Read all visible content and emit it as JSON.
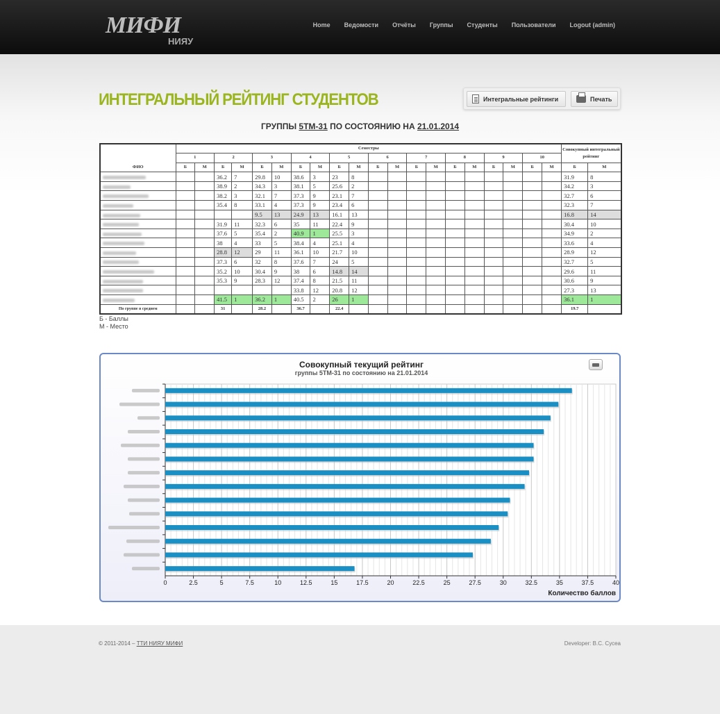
{
  "nav": {
    "logo_text": "МИФИ",
    "logo_sub": "НИЯУ",
    "items": [
      "Home",
      "Ведомости",
      "Отчёты",
      "Группы",
      "Студенты",
      "Пользователи",
      "Logout (admin)"
    ]
  },
  "page": {
    "title": "ИНТЕГРАЛЬНЫЙ РЕЙТИНГ СТУДЕНТОВ",
    "btn_ratings": "Интегральные рейтинги",
    "btn_print": "Печать",
    "subtitle_pre": "ГРУППЫ",
    "group": "5ТМ-31",
    "subtitle_mid": "ПО СОСТОЯНИЮ НА",
    "date": "21.01.2014"
  },
  "table": {
    "col_fio": "ФИО",
    "col_semesters": "Семестры",
    "col_total": "Совокупный интегральный рейтинг",
    "col_b": "Б",
    "col_m": "М",
    "semesters": [
      "1",
      "2",
      "3",
      "4",
      "5",
      "6",
      "7",
      "8",
      "9",
      "10"
    ],
    "rows": [
      {
        "blur": 62,
        "s2": [
          "36.2",
          "7",
          ""
        ],
        "s3": [
          "29.8",
          "10",
          ""
        ],
        "s4": [
          "38.6",
          "3",
          ""
        ],
        "s5": [
          "23",
          "8",
          ""
        ],
        "t": [
          "31.9",
          "8",
          ""
        ]
      },
      {
        "blur": 40,
        "s2": [
          "38.9",
          "2",
          ""
        ],
        "s3": [
          "34.3",
          "3",
          ""
        ],
        "s4": [
          "38.1",
          "5",
          ""
        ],
        "s5": [
          "25.6",
          "2",
          ""
        ],
        "t": [
          "34.2",
          "3",
          ""
        ]
      },
      {
        "blur": 66,
        "s2": [
          "38.2",
          "3",
          ""
        ],
        "s3": [
          "32.1",
          "7",
          ""
        ],
        "s4": [
          "37.3",
          "9",
          ""
        ],
        "s5": [
          "23.1",
          "7",
          ""
        ],
        "t": [
          "32.7",
          "6",
          ""
        ]
      },
      {
        "blur": 44,
        "s2": [
          "35.4",
          "8",
          ""
        ],
        "s3": [
          "33.1",
          "4",
          ""
        ],
        "s4": [
          "37.3",
          "9",
          ""
        ],
        "s5": [
          "23.4",
          "6",
          ""
        ],
        "t": [
          "32.3",
          "7",
          ""
        ]
      },
      {
        "blur": 54,
        "s2": [
          "",
          "",
          ""
        ],
        "s3": [
          "9.5",
          "13",
          "g"
        ],
        "s4": [
          "24.9",
          "13",
          "g"
        ],
        "s5": [
          "16.1",
          "13",
          ""
        ],
        "t": [
          "16.8",
          "14",
          "g"
        ]
      },
      {
        "blur": 52,
        "s2": [
          "31.9",
          "11",
          ""
        ],
        "s3": [
          "32.3",
          "6",
          ""
        ],
        "s4": [
          "35",
          "11",
          ""
        ],
        "s5": [
          "22.4",
          "9",
          ""
        ],
        "t": [
          "30.4",
          "10",
          ""
        ]
      },
      {
        "blur": 56,
        "s2": [
          "37.6",
          "5",
          ""
        ],
        "s3": [
          "35.4",
          "2",
          ""
        ],
        "s4": [
          "40.9",
          "1",
          "gr"
        ],
        "s5": [
          "25.5",
          "3",
          ""
        ],
        "t": [
          "34.9",
          "2",
          ""
        ]
      },
      {
        "blur": 60,
        "s2": [
          "38",
          "4",
          ""
        ],
        "s3": [
          "33",
          "5",
          ""
        ],
        "s4": [
          "38.4",
          "4",
          ""
        ],
        "s5": [
          "25.1",
          "4",
          ""
        ],
        "t": [
          "33.6",
          "4",
          ""
        ]
      },
      {
        "blur": 48,
        "s2": [
          "28.8",
          "12",
          "g"
        ],
        "s3": [
          "29",
          "11",
          ""
        ],
        "s4": [
          "36.1",
          "10",
          ""
        ],
        "s5": [
          "21.7",
          "10",
          ""
        ],
        "t": [
          "28.9",
          "12",
          ""
        ]
      },
      {
        "blur": 52,
        "s2": [
          "37.3",
          "6",
          ""
        ],
        "s3": [
          "32",
          "8",
          ""
        ],
        "s4": [
          "37.6",
          "7",
          ""
        ],
        "s5": [
          "24",
          "5",
          ""
        ],
        "t": [
          "32.7",
          "5",
          ""
        ]
      },
      {
        "blur": 74,
        "s2": [
          "35.2",
          "10",
          ""
        ],
        "s3": [
          "30.4",
          "9",
          ""
        ],
        "s4": [
          "38",
          "6",
          ""
        ],
        "s5": [
          "14.8",
          "14",
          "g"
        ],
        "t": [
          "29.6",
          "11",
          ""
        ]
      },
      {
        "blur": 58,
        "s2": [
          "35.3",
          "9",
          ""
        ],
        "s3": [
          "28.3",
          "12",
          ""
        ],
        "s4": [
          "37.4",
          "8",
          ""
        ],
        "s5": [
          "21.5",
          "11",
          ""
        ],
        "t": [
          "30.6",
          "9",
          ""
        ]
      },
      {
        "blur": 58,
        "s2": [
          "",
          "",
          ""
        ],
        "s3": [
          "",
          "",
          ""
        ],
        "s4": [
          "33.8",
          "12",
          ""
        ],
        "s5": [
          "20.8",
          "12",
          ""
        ],
        "t": [
          "27.3",
          "13",
          ""
        ]
      },
      {
        "blur": 46,
        "s2": [
          "41.5",
          "1",
          "gr"
        ],
        "s3": [
          "36.2",
          "1",
          "gr"
        ],
        "s4": [
          "40.5",
          "2",
          ""
        ],
        "s5": [
          "26",
          "1",
          "gr"
        ],
        "t": [
          "36.1",
          "1",
          "gr"
        ]
      }
    ],
    "avg_label": "По группе в среднем",
    "avg": {
      "s2": "31",
      "s3": "28.2",
      "s4": "36.7",
      "s5": "22.4",
      "t": "19.7"
    }
  },
  "legend": {
    "b": "Б - Баллы",
    "m": "М - Место"
  },
  "chart_data": {
    "type": "bar",
    "orientation": "horizontal",
    "title": "Совокупный текущий рейтинг",
    "subtitle": "группы 5ТМ-31 по состоянию на 21.01.2014",
    "xlabel": "Количество баллов",
    "xlim": [
      0,
      40
    ],
    "xticks": [
      "0",
      "2.5",
      "5",
      "7.5",
      "10",
      "12.5",
      "15",
      "17.5",
      "20",
      "22.5",
      "25",
      "27.5",
      "30",
      "32.5",
      "35",
      "37.5",
      "40"
    ],
    "values": [
      36.1,
      34.9,
      34.2,
      33.6,
      32.7,
      32.7,
      32.3,
      31.9,
      30.6,
      30.4,
      29.6,
      28.9,
      27.3,
      16.8
    ],
    "label_widths": [
      40,
      58,
      32,
      46,
      56,
      46,
      46,
      52,
      46,
      44,
      74,
      48,
      52,
      40
    ],
    "color": "#1a8fc4",
    "grid": true
  },
  "footer": {
    "copy": "© 2011-2014 –",
    "link": "ТТИ НИЯУ МИФИ",
    "dev": "Developer: В.С. Сусеа"
  }
}
